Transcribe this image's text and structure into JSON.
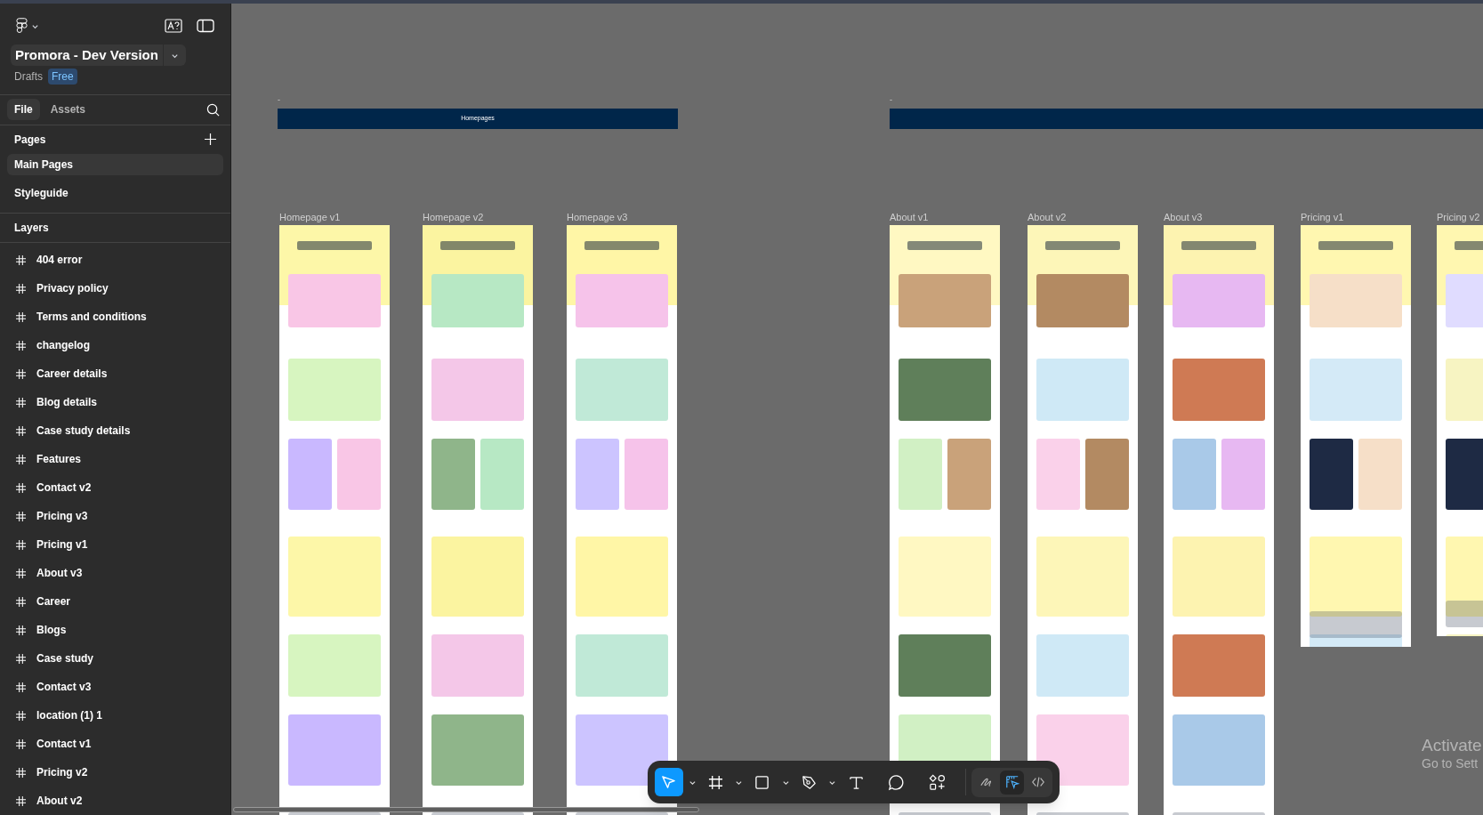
{
  "app": {
    "file_title": "Promora - Dev Version",
    "location": "Drafts",
    "plan_badge": "Free"
  },
  "panel_tabs": [
    {
      "label": "File",
      "selected": true
    },
    {
      "label": "Assets",
      "selected": false
    }
  ],
  "pages": {
    "title": "Pages",
    "items": [
      {
        "label": "Main Pages",
        "selected": true
      },
      {
        "label": "Styleguide",
        "selected": false
      }
    ]
  },
  "layers": {
    "title": "Layers",
    "items": [
      {
        "label": "404 error"
      },
      {
        "label": "Privacy policy"
      },
      {
        "label": "Terms and conditions"
      },
      {
        "label": "changelog"
      },
      {
        "label": "Career details"
      },
      {
        "label": "Blog details"
      },
      {
        "label": "Case study details"
      },
      {
        "label": "Features"
      },
      {
        "label": "Contact v2"
      },
      {
        "label": "Pricing v3"
      },
      {
        "label": "Pricing v1"
      },
      {
        "label": "About v3"
      },
      {
        "label": "Career"
      },
      {
        "label": "Blogs"
      },
      {
        "label": "Case study"
      },
      {
        "label": "Contact v3"
      },
      {
        "label": "location (1) 1"
      },
      {
        "label": "Contact v1"
      },
      {
        "label": "Pricing v2"
      },
      {
        "label": "About v2"
      }
    ]
  },
  "canvas": {
    "sections": [
      {
        "marker": "-",
        "title": "Homepages"
      },
      {
        "marker": "-"
      }
    ],
    "frames": [
      {
        "label": "Homepage v1",
        "kind": "picture"
      },
      {
        "label": "Homepage v2",
        "kind": "picture"
      },
      {
        "label": "Homepage v3",
        "kind": "picture"
      },
      {
        "label": "About v1",
        "kind": "picture"
      },
      {
        "label": "About v2",
        "kind": "picture"
      },
      {
        "label": "About v3",
        "kind": "picture"
      },
      {
        "label": "Pricing v1",
        "kind": "picture"
      },
      {
        "label": "Pricing v2",
        "kind": "picture"
      }
    ]
  },
  "toolbar": {
    "tools": [
      {
        "kind": "move",
        "selected": true,
        "menu": true
      },
      {
        "kind": "frame",
        "selected": false,
        "menu": true
      },
      {
        "kind": "rectangle",
        "selected": false,
        "menu": true
      },
      {
        "kind": "pen",
        "selected": false,
        "menu": true
      },
      {
        "kind": "text",
        "selected": false,
        "menu": false
      },
      {
        "kind": "comment",
        "selected": false,
        "menu": false
      },
      {
        "kind": "actions",
        "selected": false,
        "menu": false
      }
    ],
    "modes": [
      {
        "kind": "draw",
        "selected": false
      },
      {
        "kind": "design",
        "selected": true
      },
      {
        "kind": "dev",
        "selected": false
      }
    ]
  },
  "system_notice": {
    "title": "Activate",
    "subtitle": "Go to Sett"
  }
}
